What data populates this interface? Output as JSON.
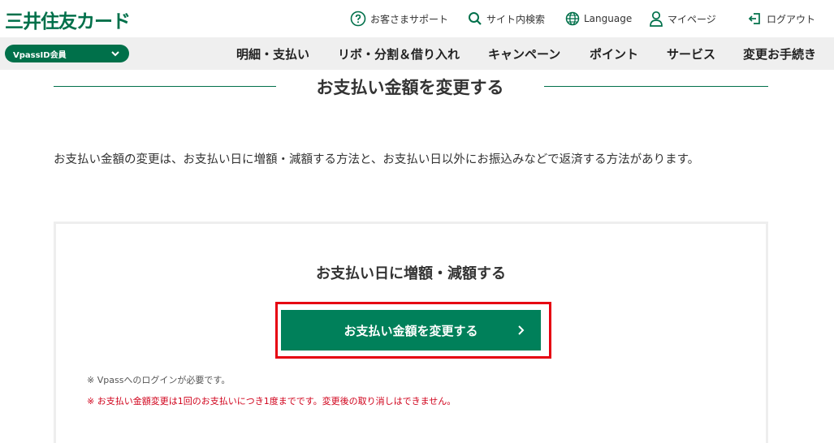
{
  "header": {
    "logo_text": "三井住友カード",
    "utility": {
      "support": "お客さまサポート",
      "search": "サイト内検索",
      "language": "Language",
      "mypage": "マイページ",
      "logout": "ログアウト"
    }
  },
  "nav": {
    "member_select": "VpassID会員",
    "items": [
      "明細・支払い",
      "リボ・分割＆借り入れ",
      "キャンペーン",
      "ポイント",
      "サービス",
      "変更お手続き"
    ]
  },
  "main": {
    "title": "お支払い金額を変更する",
    "description": "お支払い金額の変更は、お支払い日に増額・減額する方法と、お支払い日以外にお振込みなどで返済する方法があります。"
  },
  "panel": {
    "heading": "お支払い日に増額・減額する",
    "button_label": "お支払い金額を変更する",
    "note_login": "※ Vpassへのログインが必要です。",
    "note_warning": "※ お支払い金額変更は1回のお支払いにつき1度までです。変更後の取り消しはできません。"
  },
  "colors": {
    "brand_green": "#00704a",
    "button_green": "#00805a",
    "highlight_red": "#e60012",
    "warning_red": "#d0021b"
  },
  "icons": {
    "support": "question-circle-icon",
    "search": "magnifier-icon",
    "language": "globe-icon",
    "mypage": "person-icon",
    "logout": "logout-icon",
    "member_select": "chevron-down-icon",
    "button": "chevron-right-icon"
  }
}
